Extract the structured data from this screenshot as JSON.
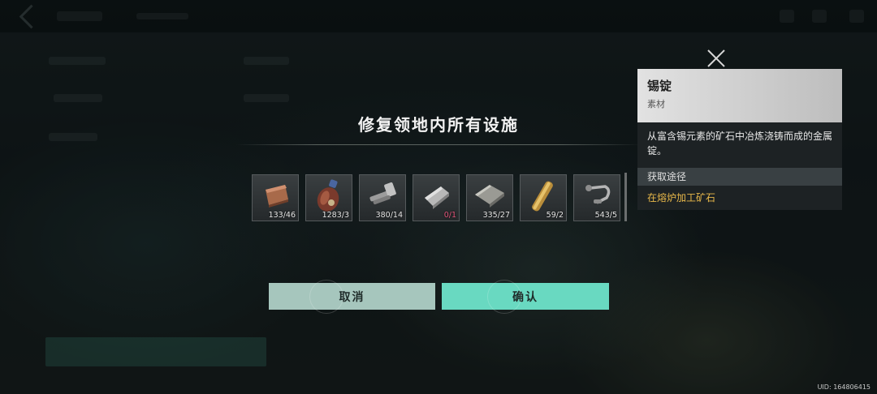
{
  "dialog": {
    "title": "修复领地内所有设施",
    "cancel_label": "取消",
    "confirm_label": "确认"
  },
  "materials": [
    {
      "icon": "copper-ingot-icon",
      "count": "133/46",
      "sufficient": true
    },
    {
      "icon": "gas-bottle-icon",
      "count": "1283/3",
      "sufficient": true
    },
    {
      "icon": "bolt-icon",
      "count": "380/14",
      "sufficient": true
    },
    {
      "icon": "tin-ingot-icon",
      "count": "0/1",
      "sufficient": false
    },
    {
      "icon": "metal-plate-icon",
      "count": "335/27",
      "sufficient": true
    },
    {
      "icon": "brass-pipe-icon",
      "count": "59/2",
      "sufficient": true
    },
    {
      "icon": "shackle-icon",
      "count": "543/5",
      "sufficient": true
    }
  ],
  "tooltip": {
    "name": "锡锭",
    "type": "素材",
    "description": "从富含锡元素的矿石中冶炼浇铸而成的金属锭。",
    "source_header": "获取途径",
    "source_link": "在熔炉加工矿石"
  },
  "footer": {
    "uid": "UID: 164806415"
  },
  "colors": {
    "confirm": "#69d9c1",
    "cancel": "#a6c6bd",
    "insufficient": "#e2557a",
    "source_link": "#e8b84a"
  }
}
